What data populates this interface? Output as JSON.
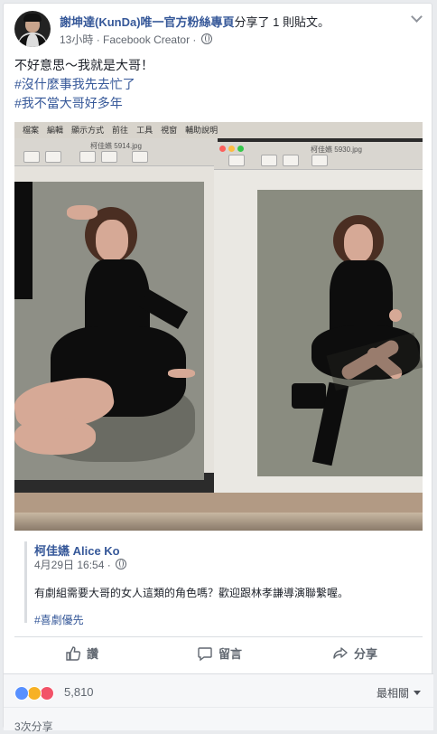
{
  "post": {
    "page_name": "謝坤達(KunDa)唯一官方粉絲專頁",
    "share_text": "分享了 1 則貼文。",
    "time": "13小時",
    "app": "Facebook Creator",
    "text_line1": "不好意思～我就是大哥！",
    "hashtag1": "#沒什麼事我先去忙了",
    "hashtag2": "#我不當大哥好多年"
  },
  "photo": {
    "menu": [
      "檔案",
      "編輯",
      "顯示方式",
      "前往",
      "工具",
      "視窗",
      "輔助說明"
    ],
    "file1": "柯佳嬿 5914.jpg",
    "file2": "柯佳嬿 5930.jpg"
  },
  "shared_post": {
    "author": "柯佳嬿 Alice Ko",
    "date": "4月29日 16:54",
    "message": "有劇組需要大哥的女人這類的角色嗎？歡迎跟林孝謙導演聯繫喔。",
    "hashtag": "#喜劇優先"
  },
  "actions": {
    "like": "讚",
    "comment": "留言",
    "share": "分享"
  },
  "reactions": {
    "count": "5,810",
    "sort_label": "最相關",
    "emoji": [
      "like-icon",
      "haha-icon",
      "love-icon"
    ]
  },
  "shares": {
    "label": "3次分享"
  },
  "colors": {
    "link": "#365899",
    "like_blue": "#5890ff",
    "love_red": "#f25268",
    "haha_yellow": "#f7b125"
  }
}
